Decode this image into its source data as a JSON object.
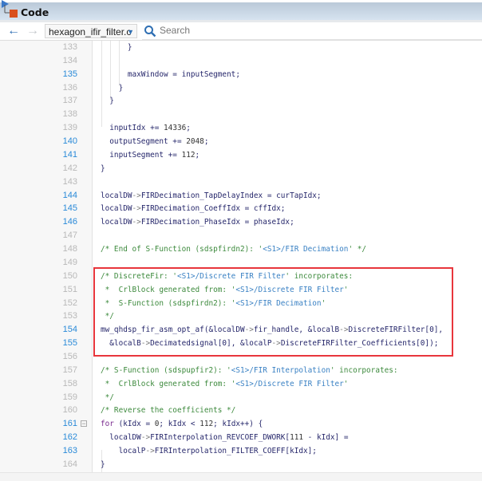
{
  "window": {
    "title": "Code"
  },
  "toolbar": {
    "file_name": "hexagon_ifir_filter.c",
    "search_placeholder": "Search"
  },
  "colors": {
    "highlight_box": "#e8363c",
    "active_line_number": "#2a8ad8",
    "comment": "#3d8a3d",
    "link": "#3b82c4"
  },
  "highlighted_range": {
    "from_line": 150,
    "to_line": 156
  },
  "lines": [
    {
      "n": "133",
      "a": false,
      "t": [
        [
          "      }",
          ""
        ]
      ]
    },
    {
      "n": "134",
      "a": false,
      "t": []
    },
    {
      "n": "135",
      "a": true,
      "t": [
        [
          "      maxWindow = inputSegment;",
          ""
        ]
      ]
    },
    {
      "n": "136",
      "a": false,
      "t": [
        [
          "    }",
          ""
        ]
      ]
    },
    {
      "n": "137",
      "a": false,
      "t": [
        [
          "  }",
          ""
        ]
      ]
    },
    {
      "n": "138",
      "a": false,
      "t": []
    },
    {
      "n": "139",
      "a": false,
      "t": [
        [
          "  inputIdx += ",
          ""
        ],
        [
          "14336",
          "num"
        ],
        [
          ";",
          ""
        ]
      ]
    },
    {
      "n": "140",
      "a": true,
      "t": [
        [
          "  outputSegment += ",
          ""
        ],
        [
          "2048",
          "num"
        ],
        [
          ";",
          ""
        ]
      ]
    },
    {
      "n": "141",
      "a": true,
      "t": [
        [
          "  inputSegment += ",
          ""
        ],
        [
          "112",
          "num"
        ],
        [
          ";",
          ""
        ]
      ]
    },
    {
      "n": "142",
      "a": false,
      "t": [
        [
          "}",
          ""
        ]
      ]
    },
    {
      "n": "143",
      "a": false,
      "t": []
    },
    {
      "n": "144",
      "a": true,
      "t": [
        [
          "localDW",
          ""
        ],
        [
          "->",
          "op"
        ],
        [
          "FIRDecimation_TapDelayIndex = curTapIdx;",
          ""
        ]
      ]
    },
    {
      "n": "145",
      "a": true,
      "t": [
        [
          "localDW",
          ""
        ],
        [
          "->",
          "op"
        ],
        [
          "FIRDecimation_CoeffIdx = cffIdx;",
          ""
        ]
      ]
    },
    {
      "n": "146",
      "a": true,
      "t": [
        [
          "localDW",
          ""
        ],
        [
          "->",
          "op"
        ],
        [
          "FIRDecimation_PhaseIdx = phaseIdx;",
          ""
        ]
      ]
    },
    {
      "n": "147",
      "a": false,
      "t": []
    },
    {
      "n": "148",
      "a": false,
      "t": [
        [
          "/* End of S-Function (sdspfirdn2): '",
          "cm"
        ],
        [
          "<S1>/FIR Decimation",
          "lk"
        ],
        [
          "' */",
          "cm"
        ]
      ]
    },
    {
      "n": "149",
      "a": false,
      "t": []
    },
    {
      "n": "150",
      "a": false,
      "t": [
        [
          "/* DiscreteFir: '",
          "cm"
        ],
        [
          "<S1>/Discrete FIR Filter",
          "lk"
        ],
        [
          "' incorporates:",
          "cm"
        ]
      ]
    },
    {
      "n": "151",
      "a": false,
      "t": [
        [
          " *  CrlBlock generated from: '",
          "cm"
        ],
        [
          "<S1>/Discrete FIR Filter",
          "lk"
        ],
        [
          "'",
          "cm"
        ]
      ]
    },
    {
      "n": "152",
      "a": false,
      "t": [
        [
          " *  S-Function (sdspfirdn2): '",
          "cm"
        ],
        [
          "<S1>/FIR Decimation",
          "lk"
        ],
        [
          "'",
          "cm"
        ]
      ]
    },
    {
      "n": "153",
      "a": false,
      "t": [
        [
          " */",
          "cm"
        ]
      ]
    },
    {
      "n": "154",
      "a": true,
      "t": [
        [
          "mw_qhdsp_fir_asm_opt_af(&localDW",
          ""
        ],
        [
          "->",
          "op"
        ],
        [
          "fir_handle, &localB",
          ""
        ],
        [
          "->",
          "op"
        ],
        [
          "DiscreteFIRFilter[0],",
          ""
        ]
      ]
    },
    {
      "n": "155",
      "a": true,
      "t": [
        [
          "  &localB",
          ""
        ],
        [
          "->",
          "op"
        ],
        [
          "Decimatedsignal[0], &localP",
          ""
        ],
        [
          "->",
          "op"
        ],
        [
          "DiscreteFIRFilter_Coefficients[0]);",
          ""
        ]
      ]
    },
    {
      "n": "156",
      "a": false,
      "t": []
    },
    {
      "n": "157",
      "a": false,
      "t": [
        [
          "/* S-Function (sdspupfir2): '",
          "cm"
        ],
        [
          "<S1>/FIR Interpolation",
          "lk"
        ],
        [
          "' incorporates:",
          "cm"
        ]
      ]
    },
    {
      "n": "158",
      "a": false,
      "t": [
        [
          " *  CrlBlock generated from: '",
          "cm"
        ],
        [
          "<S1>/Discrete FIR Filter",
          "lk"
        ],
        [
          "'",
          "cm"
        ]
      ]
    },
    {
      "n": "159",
      "a": false,
      "t": [
        [
          " */",
          "cm"
        ]
      ]
    },
    {
      "n": "160",
      "a": false,
      "t": [
        [
          "/* Reverse the coefficients */",
          "cm"
        ]
      ]
    },
    {
      "n": "161",
      "a": true,
      "fold": true,
      "t": [
        [
          "for",
          "kw"
        ],
        [
          " (kIdx = ",
          ""
        ],
        [
          "0",
          "num"
        ],
        [
          "; kIdx < ",
          ""
        ],
        [
          "112",
          "num"
        ],
        [
          "; kIdx++) {",
          ""
        ]
      ]
    },
    {
      "n": "162",
      "a": true,
      "t": [
        [
          "  localDW",
          ""
        ],
        [
          "->",
          "op"
        ],
        [
          "FIRInterpolation_REVCOEF_DWORK[",
          ""
        ],
        [
          "111",
          "num"
        ],
        [
          " - kIdx] =",
          ""
        ]
      ]
    },
    {
      "n": "163",
      "a": true,
      "t": [
        [
          "    localP",
          ""
        ],
        [
          "->",
          "op"
        ],
        [
          "FIRInterpolation_FILTER_COEFF[kIdx];",
          ""
        ]
      ]
    },
    {
      "n": "164",
      "a": false,
      "t": [
        [
          "}",
          ""
        ]
      ]
    }
  ]
}
